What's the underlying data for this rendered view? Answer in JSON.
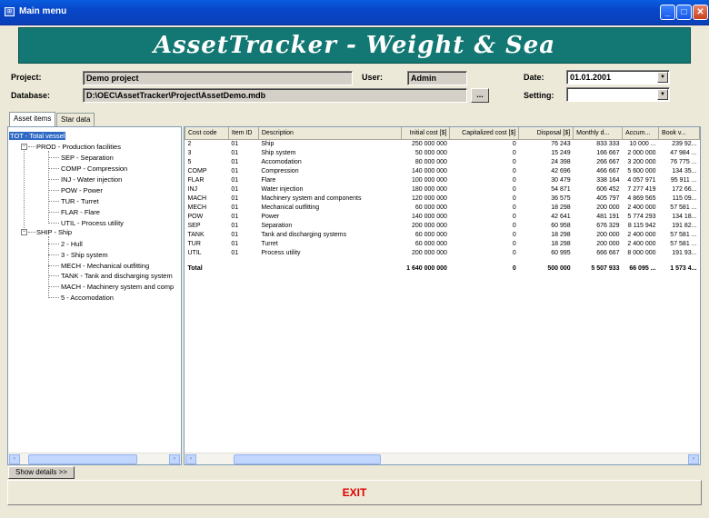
{
  "window": {
    "title": "Main menu",
    "app_icon_label": "⊞",
    "buttons": {
      "minimize": "_",
      "maximize": "□",
      "close": "✕"
    }
  },
  "banner": {
    "title": "AssetTracker - Weight & Sea"
  },
  "form": {
    "project_label": "Project:",
    "project_value": "Demo project",
    "user_label": "User:",
    "user_value": "Admin",
    "date_label": "Date:",
    "date_value": "01.01.2001",
    "database_label": "Database:",
    "database_value": "D:\\OEC\\AssetTracker\\Project\\AssetDemo.mdb",
    "browse_label": "...",
    "setting_label": "Setting:",
    "setting_value": ""
  },
  "tabs": [
    {
      "label": "Asset items",
      "active": true
    },
    {
      "label": "Star data",
      "active": false
    }
  ],
  "tree": {
    "root": "TOT - Total vessel",
    "groups": [
      {
        "label": "PROD - Production facilities",
        "children": [
          "SEP - Separation",
          "COMP - Compression",
          "INJ - Water injection",
          "POW - Power",
          "TUR - Turret",
          "FLAR - Flare",
          "UTIL - Process utility"
        ]
      },
      {
        "label": "SHIP - Ship",
        "children": [
          "2 - Hull",
          "3 - Ship system",
          "MECH - Mechanical outfitting",
          "TANK - Tank and discharging system",
          "MACH - Machinery system and comp",
          "5 - Accomodation"
        ]
      }
    ]
  },
  "table": {
    "columns": [
      "Cost code",
      "Item ID",
      "Description",
      "Initial cost [$]",
      "Capitalized cost [$]",
      "Disposal [$]",
      "Monthly d...",
      "Accum...",
      "Book v..."
    ],
    "rows": [
      [
        "2",
        "01",
        "Ship",
        "250 000 000",
        "0",
        "76 243",
        "833 333",
        "10 000 ...",
        "239 92..."
      ],
      [
        "3",
        "01",
        "Ship system",
        "50 000 000",
        "0",
        "15 249",
        "166 667",
        "2 000 000",
        "47 984 ..."
      ],
      [
        "5",
        "01",
        "Accomodation",
        "80 000 000",
        "0",
        "24 398",
        "266 667",
        "3 200 000",
        "76 775 ..."
      ],
      [
        "COMP",
        "01",
        "Compression",
        "140 000 000",
        "0",
        "42 696",
        "466 667",
        "5 600 000",
        "134 35..."
      ],
      [
        "FLAR",
        "01",
        "Flare",
        "100 000 000",
        "0",
        "30 479",
        "338 164",
        "4 057 971",
        "95 911 ..."
      ],
      [
        "INJ",
        "01",
        "Water injection",
        "180 000 000",
        "0",
        "54 871",
        "606 452",
        "7 277 419",
        "172 66..."
      ],
      [
        "MACH",
        "01",
        "Machinery system and components",
        "120 000 000",
        "0",
        "36 575",
        "405 797",
        "4 869 565",
        "115 09..."
      ],
      [
        "MECH",
        "01",
        "Mechanical outfitting",
        "60 000 000",
        "0",
        "18 298",
        "200 000",
        "2 400 000",
        "57 581 ..."
      ],
      [
        "POW",
        "01",
        "Power",
        "140 000 000",
        "0",
        "42 641",
        "481 191",
        "5 774 293",
        "134 18..."
      ],
      [
        "SEP",
        "01",
        "Separation",
        "200 000 000",
        "0",
        "60 958",
        "676 329",
        "8 115 942",
        "191 82..."
      ],
      [
        "TANK",
        "01",
        "Tank and discharging systems",
        "60 000 000",
        "0",
        "18 298",
        "200 000",
        "2 400 000",
        "57 581 ..."
      ],
      [
        "TUR",
        "01",
        "Turret",
        "60 000 000",
        "0",
        "18 298",
        "200 000",
        "2 400 000",
        "57 581 ..."
      ],
      [
        "UTIL",
        "01",
        "Process utility",
        "200 000 000",
        "0",
        "60 995",
        "666 667",
        "8 000 000",
        "191 93..."
      ]
    ],
    "total": [
      "Total",
      "",
      "",
      "1 640 000 000",
      "0",
      "500 000",
      "5 507 933",
      "66 095 ...",
      "1 573 4..."
    ]
  },
  "scroll": {
    "left": "‹",
    "right": "›"
  },
  "show_details_label": "Show details >>",
  "exit_label": "EXIT"
}
